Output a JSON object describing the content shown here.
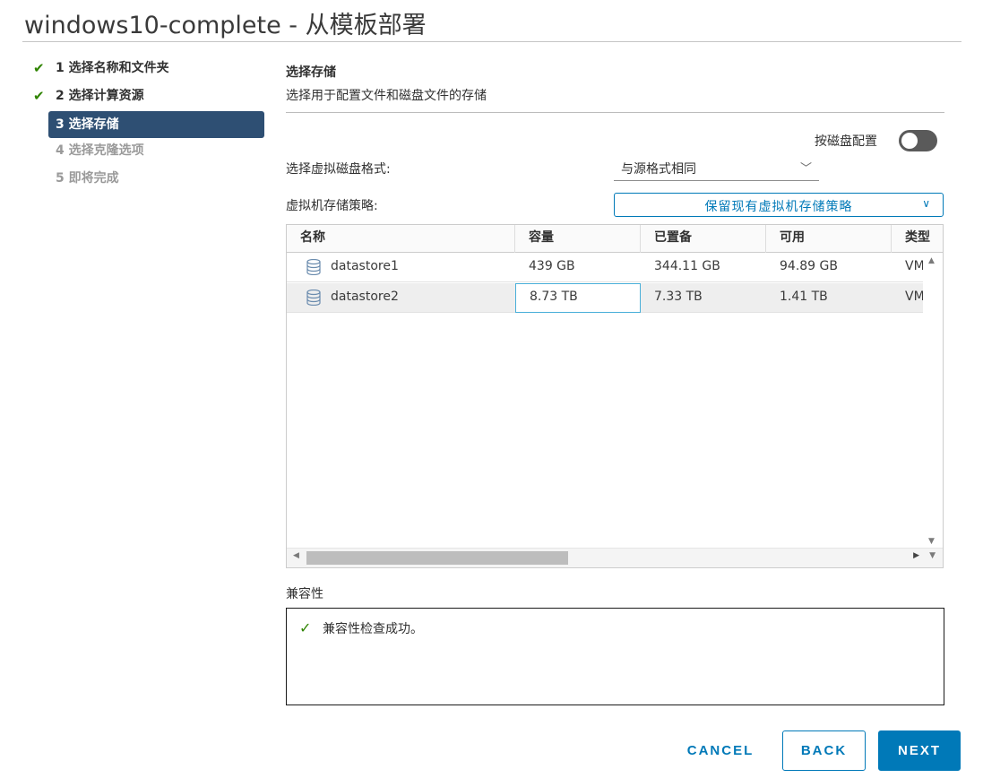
{
  "window": {
    "title": "windows10-complete - 从模板部署"
  },
  "steps": [
    {
      "label": "1 选择名称和文件夹",
      "state": "done"
    },
    {
      "label": "2 选择计算资源",
      "state": "done"
    },
    {
      "label": "3 选择存储",
      "state": "active"
    },
    {
      "label": "4 选择克隆选项",
      "state": "disabled"
    },
    {
      "label": "5 即将完成",
      "state": "disabled"
    }
  ],
  "section": {
    "title": "选择存储",
    "subtitle": "选择用于配置文件和磁盘文件的存储"
  },
  "per_disk": {
    "label": "按磁盘配置",
    "enabled": false
  },
  "disk_format": {
    "label": "选择虚拟磁盘格式:",
    "value": "与源格式相同"
  },
  "storage_policy": {
    "label": "虚拟机存储策略:",
    "value": "保留现有虚拟机存储策略"
  },
  "table": {
    "columns": [
      "名称",
      "容量",
      "已置备",
      "可用",
      "类型"
    ],
    "rows": [
      {
        "name": "datastore1",
        "capacity": "439 GB",
        "provisioned": "344.11 GB",
        "free": "94.89 GB",
        "type": "VM"
      },
      {
        "name": "datastore2",
        "capacity": "8.73 TB",
        "provisioned": "7.33 TB",
        "free": "1.41 TB",
        "type": "VM"
      }
    ],
    "selected_row": 1
  },
  "compatibility": {
    "title": "兼容性",
    "message": "兼容性检查成功。"
  },
  "buttons": {
    "cancel": "CANCEL",
    "back": "BACK",
    "next": "NEXT"
  },
  "colors": {
    "accent": "#0079b8",
    "active_step": "#2e4f73",
    "success": "#2f8400"
  },
  "icons": {
    "done": "check-icon",
    "datastore": "database-icon",
    "dropdown": "chevron-down-icon"
  }
}
